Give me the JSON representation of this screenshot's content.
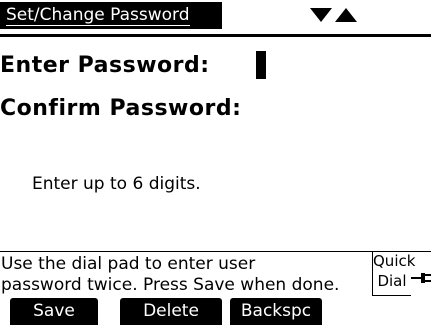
{
  "header": {
    "title": "Set/Change Password"
  },
  "form": {
    "enter_label": "Enter Password:",
    "confirm_label": "Confirm Password:",
    "hint": "Enter up to 6 digits."
  },
  "help": {
    "line1": "Use the dial pad to enter user",
    "line2": "password twice. Press Save when done.",
    "quick_dial_line1": "Quick",
    "quick_dial_line2": "Dial"
  },
  "softkeys": {
    "save": "Save",
    "delete": "Delete",
    "backspace": "Backspc"
  },
  "icons": {
    "scroll_down": "triangle-down-icon",
    "scroll_up": "triangle-up-icon",
    "quick_dial": "plug-icon"
  }
}
